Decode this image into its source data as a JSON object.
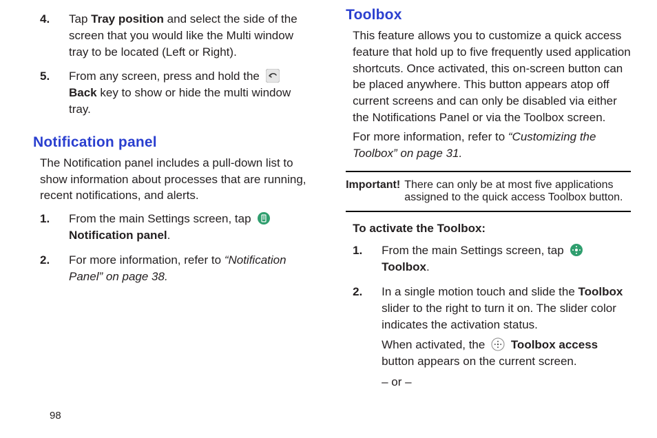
{
  "page_number": "98",
  "left": {
    "step4": {
      "num": "4.",
      "before": "Tap ",
      "bold": "Tray position",
      "after": " and select the side of the screen that you would like the Multi window tray to be located (Left or Right)."
    },
    "step5": {
      "num": "5.",
      "before": "From any screen, press and hold the ",
      "bold": "Back",
      "after": " key to show or hide the multi window tray."
    },
    "heading": "Notification panel",
    "intro": "The Notification panel includes a pull-down list to show information about processes that are running, recent notifications, and alerts.",
    "np_step1": {
      "num": "1.",
      "before": "From the main Settings screen, tap ",
      "bold": "Notification panel",
      "after": "."
    },
    "np_step2": {
      "num": "2.",
      "before": "For more information, refer to ",
      "italic": "“Notification Panel”  on page 38.",
      "after": ""
    }
  },
  "right": {
    "heading": "Toolbox",
    "intro1": "This feature allows you to customize a quick access feature that hold up to five frequently used application shortcuts. Once activated, this on-screen button can be placed anywhere. This button appears atop off current screens and can only be disabled via either the Notifications Panel or via the Toolbox screen.",
    "intro2_before": "For more information, refer to ",
    "intro2_italic": "“Customizing the Toolbox”  on page 31.",
    "important_label": "Important!",
    "important_text": "There can only be at most five applications assigned to the quick access Toolbox button.",
    "activate_heading": "To activate the Toolbox:",
    "tb_step1": {
      "num": "1.",
      "before": "From the main Settings screen, tap ",
      "bold": "Toolbox",
      "after": "."
    },
    "tb_step2": {
      "num": "2.",
      "before": "In a single motion touch and slide the ",
      "bold": "Toolbox",
      "after": " slider to the right to turn it on. The slider color indicates the activation status.",
      "sub_before": "When activated, the ",
      "sub_bold": "Toolbox access",
      "sub_after": " button appears on the current screen.",
      "or": "– or –"
    }
  }
}
